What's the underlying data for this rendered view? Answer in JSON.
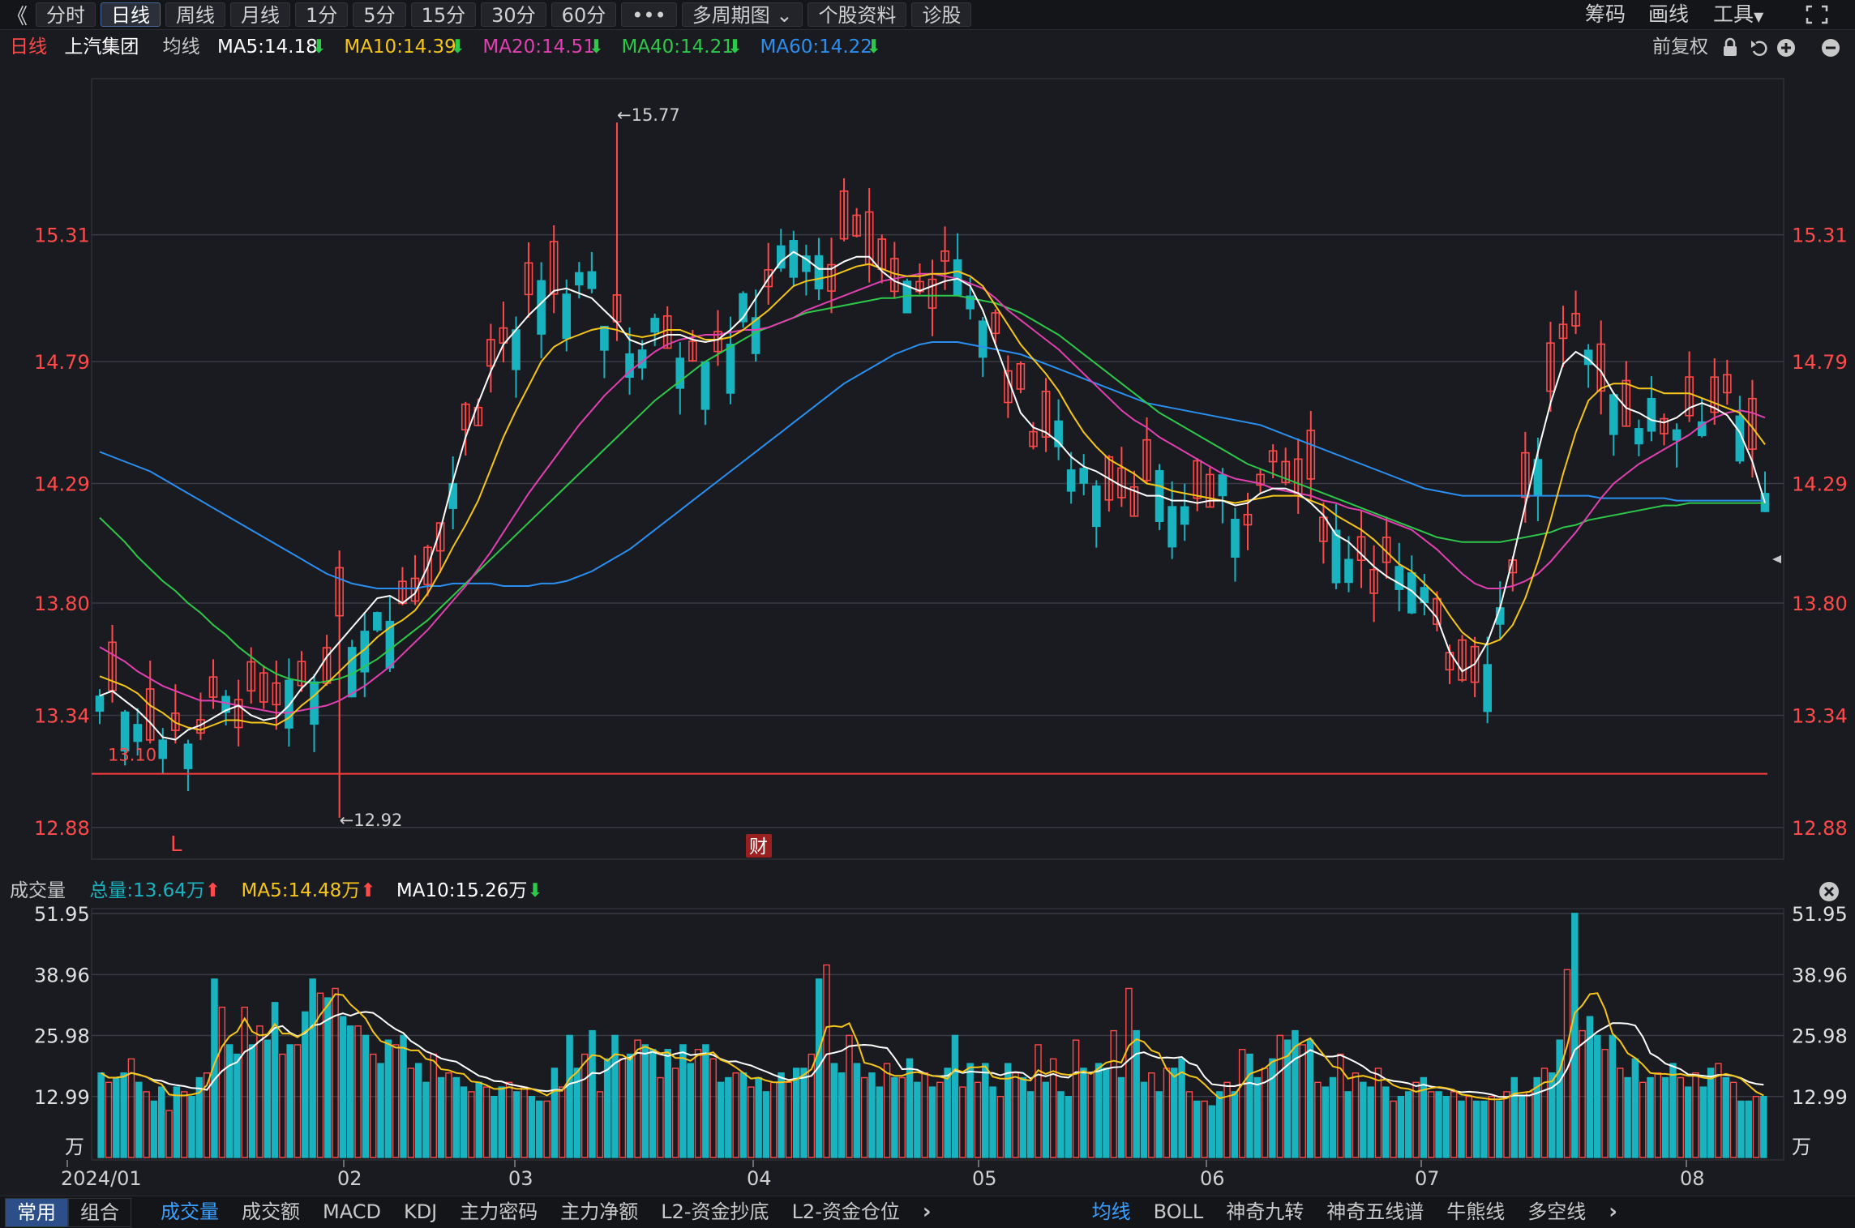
{
  "toolbar": {
    "back_glyph": "《",
    "periods": [
      "分时",
      "日线",
      "周线",
      "月线",
      "1分",
      "5分",
      "15分",
      "30分",
      "60分",
      "•••",
      "多周期图 ⌄",
      "个股资料",
      "诊股"
    ],
    "active_period": "日线",
    "right": {
      "chips": "筹码",
      "draw": "画线",
      "tools": "工具"
    }
  },
  "info": {
    "period": "日线",
    "stock_name": "上汽集团",
    "ma_label": "均线",
    "ma5": "MA5:14.18",
    "ma10": "MA10:14.39",
    "ma20": "MA20:14.51",
    "ma40": "MA40:14.21",
    "ma60": "MA60:14.22",
    "adjust": "前复权"
  },
  "colors": {
    "up": "#ff4a4a",
    "down": "#19b3c0",
    "ma5": "#ffffff",
    "ma10": "#f5c518",
    "ma20": "#e040b0",
    "ma40": "#2ec84a",
    "ma60": "#2a8ff0",
    "grid": "#3a3b42",
    "axis_text": "#ff4a4a",
    "vol_axis_text": "#e0e0e0",
    "support_line": "#ff3b3b"
  },
  "price_axis": {
    "ticks": [
      "15.31",
      "14.79",
      "14.29",
      "13.80",
      "13.34",
      "12.88"
    ]
  },
  "annotations": {
    "high": "←15.77",
    "low": "←12.92",
    "support": "13.10",
    "marker_l": "L",
    "marker_cai": "财"
  },
  "volume": {
    "label": "成交量",
    "total": "总量:13.64万",
    "ma5": "MA5:14.48万",
    "ma10": "MA10:15.26万",
    "ticks": [
      "51.95",
      "38.96",
      "25.98",
      "12.99"
    ],
    "unit": "万"
  },
  "time_axis": [
    "2024/01",
    "02",
    "03",
    "04",
    "05",
    "06",
    "07",
    "08"
  ],
  "bottom": {
    "left_tabs": [
      "常用",
      "组合"
    ],
    "indicators": [
      "成交量",
      "成交额",
      "MACD",
      "KDJ",
      "主力密码",
      "主力净额",
      "L2-资金抄底",
      "L2-资金仓位"
    ],
    "overlays": [
      "均线",
      "BOLL",
      "神奇九转",
      "神奇五线谱",
      "牛熊线",
      "多空线"
    ]
  },
  "chart_data": {
    "type": "candlestick",
    "price_range": [
      12.75,
      15.95
    ],
    "volume_range": [
      0,
      53
    ],
    "high_marker": 15.77,
    "low_marker": 12.92,
    "support_level": 13.1,
    "ma5": [
      13.42,
      13.44,
      13.4,
      13.36,
      13.31,
      13.25,
      13.24,
      13.28,
      13.3,
      13.33,
      13.36,
      13.38,
      13.34,
      13.32,
      13.33,
      13.38,
      13.45,
      13.5,
      13.58,
      13.64,
      13.7,
      13.76,
      13.82,
      13.83,
      13.8,
      13.84,
      13.95,
      14.1,
      14.3,
      14.48,
      14.62,
      14.75,
      14.86,
      14.92,
      14.98,
      15.03,
      15.08,
      15.09,
      15.07,
      15.05,
      15.0,
      14.95,
      14.88,
      14.86,
      14.88,
      14.9,
      14.9,
      14.88,
      14.87,
      14.88,
      14.92,
      14.97,
      15.05,
      15.13,
      15.2,
      15.24,
      15.21,
      15.17,
      15.17,
      15.2,
      15.22,
      15.22,
      15.16,
      15.12,
      15.1,
      15.08,
      15.1,
      15.12,
      15.13,
      15.1,
      15.0,
      14.86,
      14.72,
      14.58,
      14.52,
      14.5,
      14.46,
      14.4,
      14.36,
      14.34,
      14.31,
      14.28,
      14.26,
      14.24,
      14.24,
      14.22,
      14.22,
      14.21,
      14.22,
      14.22,
      14.2,
      14.21,
      14.25,
      14.27,
      14.27,
      14.25,
      14.21,
      14.16,
      14.08,
      14.05,
      14.0,
      13.95,
      13.91,
      13.88,
      13.85,
      13.8,
      13.74,
      13.6,
      13.52,
      13.55,
      13.64,
      13.78,
      13.98,
      14.2,
      14.42,
      14.62,
      14.78,
      14.83,
      14.8,
      14.75,
      14.66,
      14.6,
      14.58,
      14.55,
      14.54,
      14.56,
      14.6,
      14.62,
      14.6,
      14.57,
      14.5,
      14.38,
      14.21
    ],
    "ma10": [
      13.5,
      13.48,
      13.46,
      13.43,
      13.38,
      13.35,
      13.31,
      13.29,
      13.28,
      13.3,
      13.32,
      13.32,
      13.31,
      13.31,
      13.3,
      13.33,
      13.38,
      13.42,
      13.47,
      13.52,
      13.57,
      13.61,
      13.66,
      13.7,
      13.73,
      13.77,
      13.84,
      13.93,
      14.03,
      14.12,
      14.22,
      14.35,
      14.48,
      14.59,
      14.69,
      14.79,
      14.85,
      14.88,
      14.9,
      14.92,
      14.93,
      14.92,
      14.9,
      14.89,
      14.9,
      14.92,
      14.92,
      14.9,
      14.88,
      14.88,
      14.89,
      14.92,
      14.96,
      15.0,
      15.05,
      15.1,
      15.12,
      15.13,
      15.14,
      15.16,
      15.18,
      15.19,
      15.17,
      15.15,
      15.14,
      15.14,
      15.15,
      15.15,
      15.16,
      15.14,
      15.1,
      15.02,
      14.94,
      14.86,
      14.8,
      14.74,
      14.67,
      14.58,
      14.5,
      14.44,
      14.39,
      14.36,
      14.33,
      14.29,
      14.28,
      14.26,
      14.25,
      14.24,
      14.23,
      14.22,
      14.21,
      14.22,
      14.23,
      14.24,
      14.24,
      14.24,
      14.22,
      14.2,
      14.16,
      14.13,
      14.1,
      14.06,
      14.01,
      13.96,
      13.93,
      13.88,
      13.83,
      13.75,
      13.68,
      13.64,
      13.63,
      13.65,
      13.71,
      13.82,
      13.97,
      14.14,
      14.33,
      14.5,
      14.63,
      14.68,
      14.7,
      14.7,
      14.68,
      14.68,
      14.66,
      14.66,
      14.66,
      14.64,
      14.62,
      14.6,
      14.58,
      14.52,
      14.45
    ],
    "ma20": [
      13.62,
      13.59,
      13.56,
      13.52,
      13.49,
      13.46,
      13.44,
      13.42,
      13.4,
      13.4,
      13.39,
      13.38,
      13.37,
      13.36,
      13.35,
      13.35,
      13.36,
      13.37,
      13.38,
      13.4,
      13.43,
      13.46,
      13.5,
      13.54,
      13.59,
      13.64,
      13.69,
      13.75,
      13.81,
      13.87,
      13.94,
      14.01,
      14.09,
      14.17,
      14.25,
      14.32,
      14.39,
      14.46,
      14.53,
      14.59,
      14.65,
      14.7,
      14.75,
      14.79,
      14.83,
      14.86,
      14.88,
      14.89,
      14.9,
      14.9,
      14.91,
      14.92,
      14.92,
      14.93,
      14.95,
      14.97,
      15.0,
      15.02,
      15.04,
      15.06,
      15.08,
      15.1,
      15.12,
      15.13,
      15.14,
      15.15,
      15.15,
      15.14,
      15.13,
      15.11,
      15.09,
      15.05,
      15.0,
      14.96,
      14.92,
      14.88,
      14.84,
      14.79,
      14.74,
      14.69,
      14.64,
      14.59,
      14.55,
      14.52,
      14.48,
      14.45,
      14.42,
      14.39,
      14.36,
      14.33,
      14.31,
      14.3,
      14.29,
      14.27,
      14.26,
      14.25,
      14.24,
      14.22,
      14.21,
      14.19,
      14.18,
      14.16,
      14.14,
      14.12,
      14.1,
      14.06,
      14.02,
      13.97,
      13.92,
      13.88,
      13.86,
      13.86,
      13.87,
      13.89,
      13.92,
      13.97,
      14.03,
      14.09,
      14.16,
      14.23,
      14.29,
      14.33,
      14.37,
      14.4,
      14.43,
      14.46,
      14.49,
      14.53,
      14.56,
      14.58,
      14.59,
      14.58,
      14.56
    ],
    "ma40": [
      14.15,
      14.1,
      14.05,
      13.99,
      13.94,
      13.89,
      13.85,
      13.8,
      13.76,
      13.71,
      13.67,
      13.62,
      13.58,
      13.54,
      13.51,
      13.49,
      13.48,
      13.47,
      13.48,
      13.49,
      13.51,
      13.54,
      13.57,
      13.61,
      13.65,
      13.69,
      13.73,
      13.78,
      13.83,
      13.88,
      13.93,
      13.98,
      14.03,
      14.08,
      14.13,
      14.18,
      14.23,
      14.28,
      14.33,
      14.38,
      14.43,
      14.48,
      14.53,
      14.58,
      14.63,
      14.67,
      14.71,
      14.75,
      14.79,
      14.82,
      14.85,
      14.88,
      14.91,
      14.93,
      14.95,
      14.97,
      14.99,
      15.0,
      15.01,
      15.02,
      15.03,
      15.04,
      15.05,
      15.05,
      15.06,
      15.06,
      15.06,
      15.06,
      15.06,
      15.05,
      15.04,
      15.03,
      15.01,
      14.99,
      14.96,
      14.93,
      14.9,
      14.86,
      14.82,
      14.78,
      14.74,
      14.7,
      14.66,
      14.62,
      14.58,
      14.55,
      14.52,
      14.49,
      14.46,
      14.43,
      14.4,
      14.37,
      14.35,
      14.33,
      14.31,
      14.29,
      14.27,
      14.25,
      14.23,
      14.21,
      14.19,
      14.17,
      14.15,
      14.13,
      14.11,
      14.09,
      14.07,
      14.06,
      14.05,
      14.05,
      14.05,
      14.05,
      14.06,
      14.07,
      14.08,
      14.09,
      14.11,
      14.12,
      14.14,
      14.15,
      14.16,
      14.17,
      14.18,
      14.19,
      14.2,
      14.2,
      14.21,
      14.21,
      14.21,
      14.21,
      14.21,
      14.21,
      14.21
    ],
    "ma60": [
      14.42,
      14.4,
      14.38,
      14.36,
      14.34,
      14.31,
      14.28,
      14.25,
      14.22,
      14.19,
      14.16,
      14.13,
      14.1,
      14.07,
      14.04,
      14.01,
      13.98,
      13.95,
      13.92,
      13.9,
      13.88,
      13.87,
      13.86,
      13.86,
      13.86,
      13.86,
      13.87,
      13.87,
      13.88,
      13.88,
      13.88,
      13.88,
      13.87,
      13.87,
      13.87,
      13.88,
      13.88,
      13.89,
      13.91,
      13.93,
      13.96,
      13.99,
      14.02,
      14.06,
      14.1,
      14.14,
      14.18,
      14.22,
      14.26,
      14.3,
      14.34,
      14.38,
      14.42,
      14.46,
      14.5,
      14.54,
      14.58,
      14.62,
      14.66,
      14.7,
      14.73,
      14.76,
      14.79,
      14.82,
      14.84,
      14.86,
      14.87,
      14.87,
      14.87,
      14.86,
      14.85,
      14.84,
      14.83,
      14.82,
      14.8,
      14.78,
      14.76,
      14.74,
      14.72,
      14.7,
      14.68,
      14.66,
      14.64,
      14.62,
      14.61,
      14.6,
      14.59,
      14.58,
      14.57,
      14.56,
      14.55,
      14.54,
      14.53,
      14.51,
      14.49,
      14.47,
      14.45,
      14.43,
      14.41,
      14.39,
      14.37,
      14.35,
      14.33,
      14.31,
      14.29,
      14.27,
      14.26,
      14.25,
      14.24,
      14.24,
      14.24,
      14.24,
      14.24,
      14.24,
      14.24,
      14.24,
      14.24,
      14.24,
      14.24,
      14.23,
      14.23,
      14.23,
      14.23,
      14.23,
      14.23,
      14.22,
      14.22,
      14.22,
      14.22,
      14.22,
      14.22,
      14.22,
      14.22
    ],
    "volume": [
      18,
      16,
      17,
      18,
      21,
      16,
      14,
      12,
      15,
      10,
      15,
      14,
      13,
      17,
      18,
      38,
      32,
      24,
      22,
      32,
      24,
      28,
      25,
      33,
      22,
      24,
      24,
      31,
      38,
      35,
      34,
      36,
      30,
      28,
      28,
      26,
      22,
      20,
      25,
      24,
      26,
      19,
      20,
      16,
      22,
      17,
      18,
      17,
      15,
      14,
      16,
      15,
      13,
      15,
      16,
      14,
      15,
      13,
      12,
      12,
      19,
      15,
      26,
      19,
      22,
      27,
      14,
      21,
      26,
      21,
      22,
      25,
      24,
      23,
      17,
      23,
      19,
      24,
      20,
      23,
      24,
      21,
      16,
      17,
      18,
      18,
      15,
      17,
      14,
      16,
      18,
      16,
      19,
      19,
      22,
      38,
      41,
      20,
      18,
      26,
      20,
      17,
      18,
      15,
      20,
      17,
      17,
      21,
      16,
      18,
      15,
      16,
      19,
      26,
      15,
      20,
      16,
      20,
      15,
      13,
      20,
      18,
      17,
      14,
      24,
      16,
      21,
      14,
      13,
      25,
      19,
      18,
      20,
      19,
      27,
      17,
      36,
      27,
      16,
      18,
      14,
      19,
      19,
      21,
      14,
      12,
      12,
      11,
      14,
      16,
      14,
      23,
      22,
      17,
      19,
      21,
      26,
      25,
      27,
      24,
      25,
      16,
      15,
      17,
      22,
      14,
      18,
      16,
      15,
      19,
      15,
      12,
      13,
      14,
      16,
      17,
      14,
      14,
      13,
      14,
      12,
      13,
      12,
      12,
      13,
      12,
      14,
      17,
      13,
      14,
      17,
      19,
      18,
      25,
      40,
      52,
      27,
      30,
      26,
      23,
      26,
      19,
      17,
      21,
      16,
      17,
      18,
      17,
      20,
      17,
      15,
      18,
      15,
      19,
      20,
      17,
      16,
      12,
      12,
      13,
      13
    ]
  }
}
